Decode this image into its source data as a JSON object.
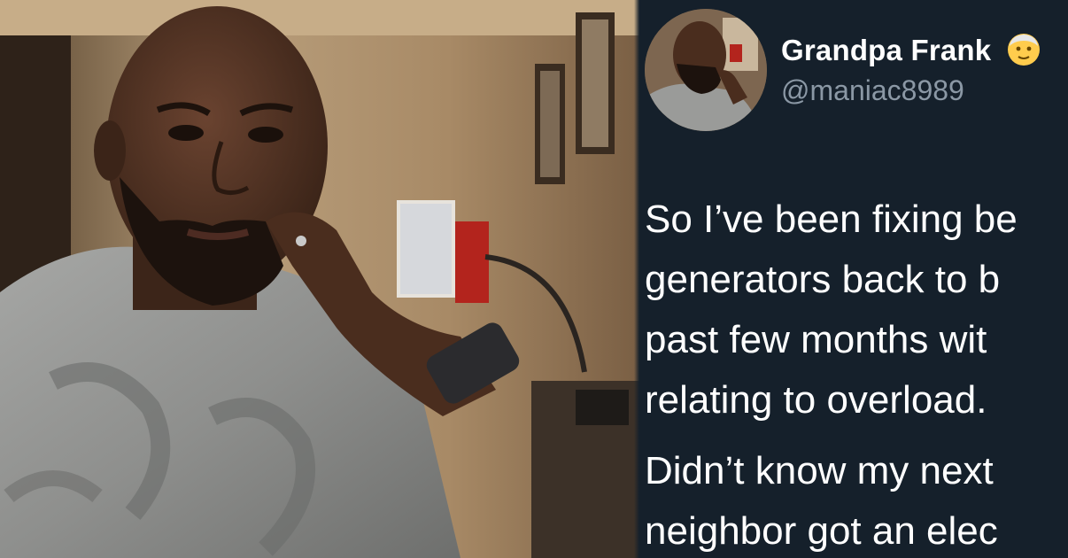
{
  "tweet": {
    "display_name": "Grandpa Frank",
    "name_emoji_icon": "older-man-emoji-icon",
    "handle": "@maniac8989",
    "paragraphs": [
      {
        "lines": [
          "So I’ve been fixing be",
          "generators back to b",
          "past few months wit",
          "relating to overload."
        ]
      },
      {
        "lines": [
          "Didn’t know my next",
          "neighbor got an elec"
        ]
      }
    ]
  },
  "photo": {
    "subject_icon": "man-portrait-photo"
  },
  "colors": {
    "background": "#15202b",
    "text_primary": "#ffffff",
    "text_secondary": "#8b98a5",
    "shirt": "#8d8e8c",
    "skin": "#4a2e1f"
  }
}
